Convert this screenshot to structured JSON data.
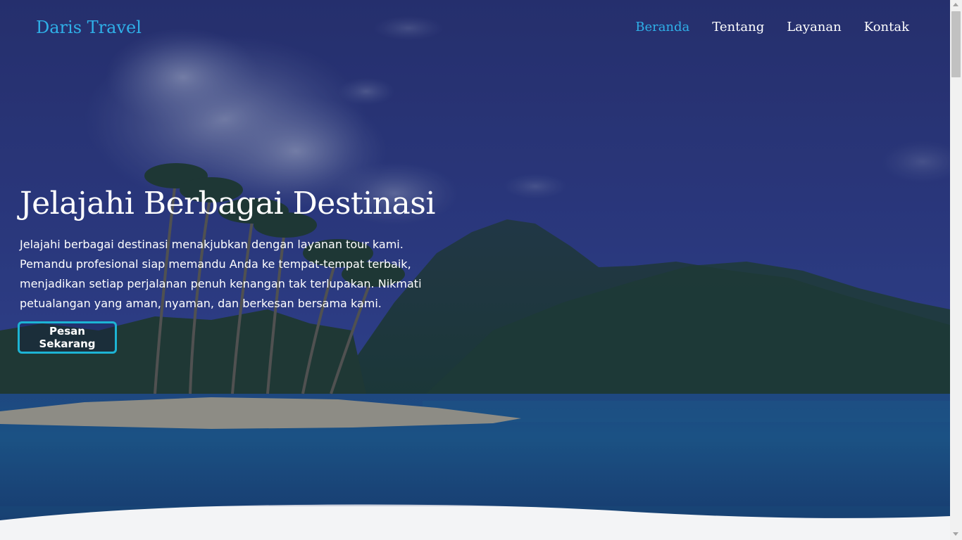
{
  "nav": {
    "brand": "Daris Travel",
    "links": [
      {
        "label": "Beranda",
        "active": true
      },
      {
        "label": "Tentang",
        "active": false
      },
      {
        "label": "Layanan",
        "active": false
      },
      {
        "label": "Kontak",
        "active": false
      }
    ]
  },
  "hero": {
    "title": "Jelajahi Berbagai Destinasi",
    "description": "Jelajahi berbagai destinasi menakjubkan dengan layanan tour kami. Pemandu profesional siap memandu Anda ke tempat-tempat terbaik, menjadikan setiap perjalanan penuh kenangan tak terlupakan. Nikmati petualangan yang aman, nyaman, dan berkesan bersama kami.",
    "cta_label": "Pesan Sekarang"
  },
  "colors": {
    "accent": "#2fb0e8",
    "button_border": "#1db4d4",
    "overlay": "#1e2a6b",
    "wave": "#f3f4f6"
  }
}
